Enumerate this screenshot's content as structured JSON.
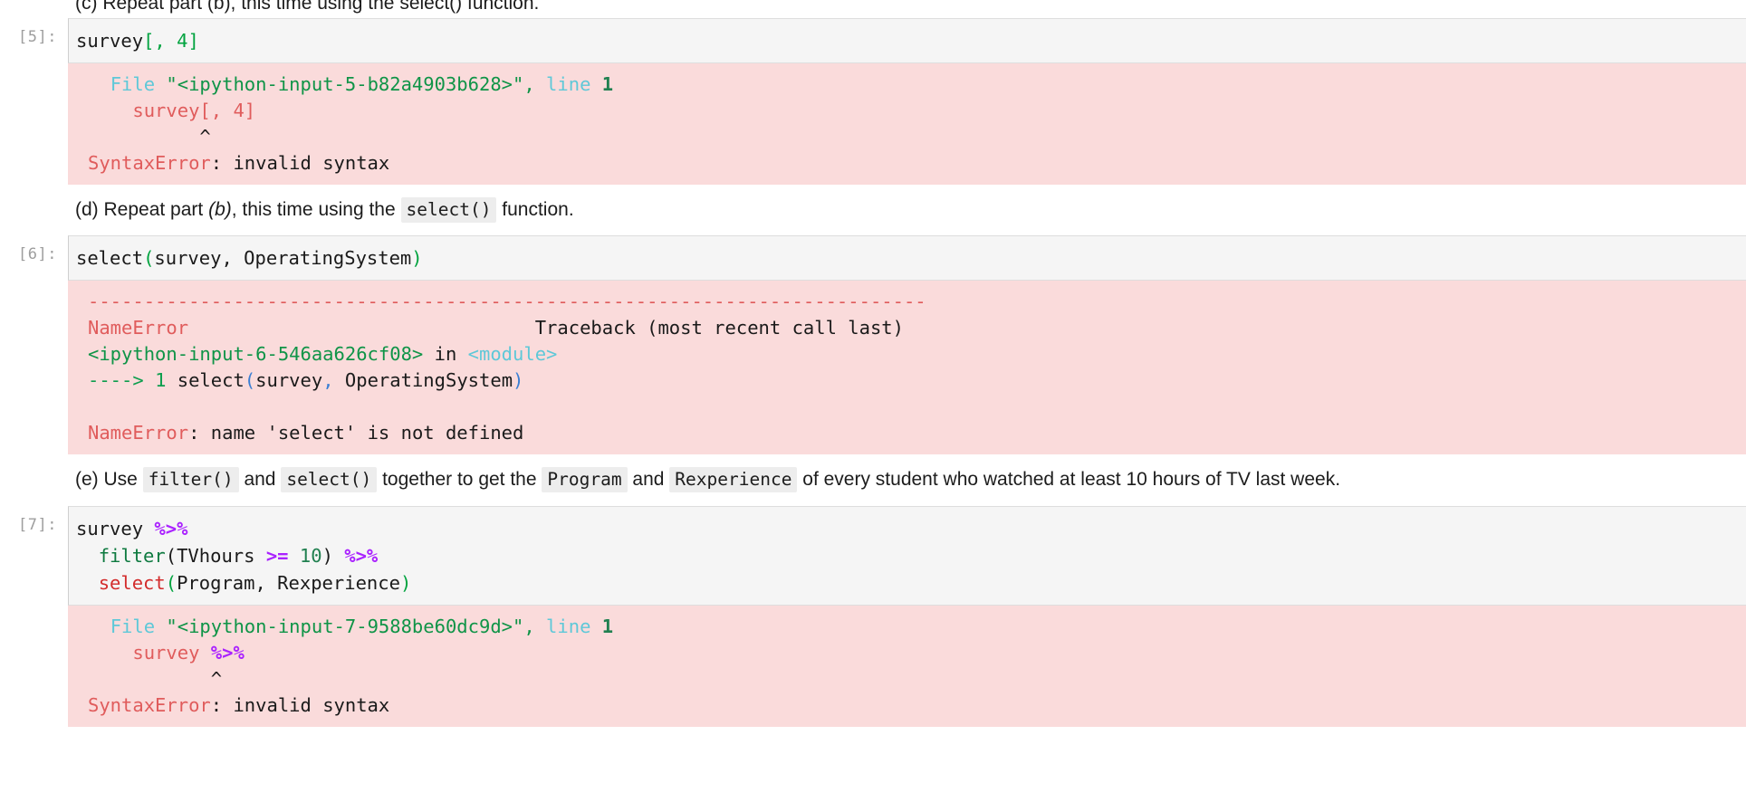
{
  "notebook": {
    "clipped_top_text": "(c) Repeat part (b), this time using the select() function."
  },
  "cells": [
    {
      "prompt": "[5]:",
      "code_plain": "survey[, 4]",
      "code_tokens": {
        "name": "survey",
        "bracket_open": "[",
        "comma_space": ", ",
        "number": "4",
        "bracket_close": "]"
      },
      "output": {
        "type": "SyntaxError",
        "file_kw": "File",
        "file_name": "\"<ipython-input-5-b82a4903b628>\"",
        "comma": ",",
        "line_kw": "line",
        "line_no": "1",
        "source_line": "survey[, 4]",
        "caret": "^",
        "error_name": "SyntaxError",
        "error_sep": ": ",
        "error_msg": "invalid syntax"
      }
    },
    {
      "prompt": "[6]:",
      "code_plain": "select(survey, OperatingSystem)",
      "code_tokens": {
        "fn": "select",
        "paren_open": "(",
        "args": "survey, OperatingSystem",
        "paren_close": ")"
      },
      "output": {
        "type": "NameError",
        "dashes": "---------------------------------------------------------------------------",
        "error_name": "NameError",
        "traceback_label": "Traceback (most recent call last)",
        "frame_file": "<ipython-input-6-546aa626cf08>",
        "frame_in": " in ",
        "frame_module": "<module>",
        "arrow": "----> ",
        "arrow_lineno": "1",
        "arrow_code_fn": " select",
        "arrow_paren_open": "(",
        "arrow_args_a": "survey",
        "arrow_comma": ",",
        "arrow_args_b": " OperatingSystem",
        "arrow_paren_close": ")",
        "final_error_name": "NameError",
        "final_error_sep": ": ",
        "final_error_msg": "name 'select' is not defined"
      }
    },
    {
      "prompt": "[7]:",
      "code_lines": [
        "survey %>%",
        "  filter(TVhours >= 10) %>%",
        "  select(Program, Rexperience)"
      ],
      "code_tokens": {
        "l1_name": "survey ",
        "l1_pipe": "%>%",
        "l2_indent": "  ",
        "l2_fn": "filter",
        "l2_paren_open": "(",
        "l2_arg": "TVhours ",
        "l2_cmp": ">=",
        "l2_space": " ",
        "l2_num": "10",
        "l2_paren_close": ")",
        "l2_pipe": " %>%",
        "l3_indent": "  ",
        "l3_fn": "select",
        "l3_paren_open": "(",
        "l3_args": "Program, Rexperience",
        "l3_paren_close": ")"
      },
      "output": {
        "type": "SyntaxError",
        "file_kw": "File",
        "file_name": "\"<ipython-input-7-9588be60dc9d>\"",
        "comma": ",",
        "line_kw": "line",
        "line_no": "1",
        "source_line_name": "survey ",
        "source_line_pipe": "%>%",
        "caret": "^",
        "error_name": "SyntaxError",
        "error_sep": ": ",
        "error_msg": "invalid syntax"
      }
    }
  ],
  "markdown": {
    "part_d": {
      "lead": "(d) Repeat part ",
      "italic_ref": "(b)",
      "mid": ", this time using the ",
      "code": "select()",
      "tail": " function."
    },
    "part_e": {
      "lead": "(e) Use ",
      "code1": "filter()",
      "mid1": " and ",
      "code2": "select()",
      "mid2": " together to get the ",
      "code3": "Program",
      "mid3": " and ",
      "code4": "Rexperience",
      "tail": " of every student who watched at least 10 hours of TV last week."
    }
  },
  "colors": {
    "input_bg": "#f5f5f5",
    "error_bg": "#fadbdb",
    "prompt_gray": "#9e9e9e",
    "error_red": "#e05c5c",
    "green": "#0f9447",
    "cyan": "#5ec8d8",
    "purple": "#aa22ff",
    "bracket_green": "#00a33f",
    "fn_red": "#d32c2c"
  }
}
